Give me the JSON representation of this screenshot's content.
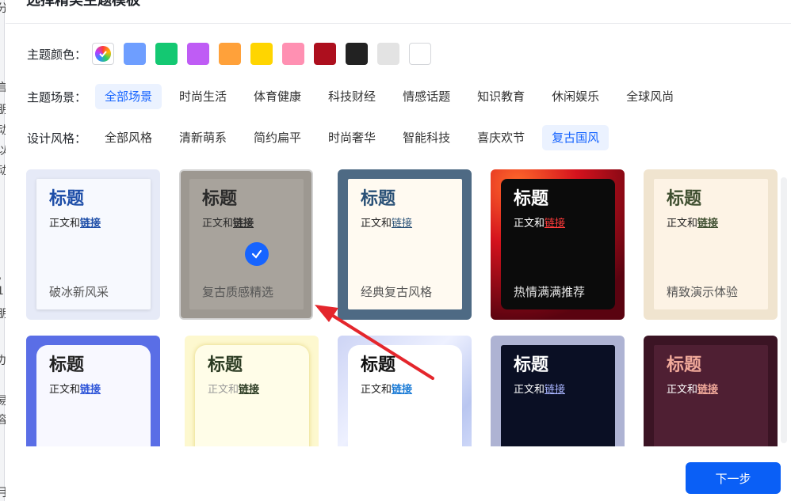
{
  "dialog": {
    "title": "选择精美主题模板"
  },
  "theme_color": {
    "label": "主题颜色：",
    "swatches": [
      "#6e9eff",
      "#14c872",
      "#bf5cf5",
      "#ffa13a",
      "#ffd500",
      "#ff90b2",
      "#ad0f1e",
      "#222222",
      "#e3e3e3",
      "#ffffff"
    ]
  },
  "scene": {
    "label": "主题场景：",
    "options": [
      "全部场景",
      "时尚生活",
      "体育健康",
      "科技财经",
      "情感话题",
      "知识教育",
      "休闲娱乐",
      "全球风尚"
    ],
    "selected": "全部场景"
  },
  "style": {
    "label": "设计风格：",
    "options": [
      "全部风格",
      "清新萌系",
      "简约扁平",
      "时尚奢华",
      "智能科技",
      "喜庆欢节",
      "复古国风"
    ],
    "selected": "复古国风"
  },
  "templates": [
    {
      "title": "标题",
      "body": "正文和",
      "link": "链接",
      "footer": "破冰新风采"
    },
    {
      "title": "标题",
      "body": "正文和",
      "link": "链接",
      "footer": "复古质感精选",
      "selected": true
    },
    {
      "title": "标题",
      "body": "正文和",
      "link": "链接",
      "footer": "经典复古风格"
    },
    {
      "title": "标题",
      "body": "正文和",
      "link": "链接",
      "footer": "热情满满推荐"
    },
    {
      "title": "标题",
      "body": "正文和",
      "link": "链接",
      "footer": "精致演示体验"
    },
    {
      "title": "标题",
      "body": "正文和",
      "link": "链接"
    },
    {
      "title": "标题",
      "body": "正文和",
      "link": "链接"
    },
    {
      "title": "标题",
      "body": "正文和",
      "link": "链接"
    },
    {
      "title": "标题",
      "body": "正文和",
      "link": "链接"
    },
    {
      "title": "标题",
      "body": "正文和",
      "link": "链接"
    }
  ],
  "next_button": {
    "label": "下一步"
  },
  "background_text": [
    "分",
    "言",
    "朋",
    "动",
    "以",
    "动",
    "。",
    "1",
    "朋",
    "办",
    "易",
    "容",
    "月"
  ]
}
